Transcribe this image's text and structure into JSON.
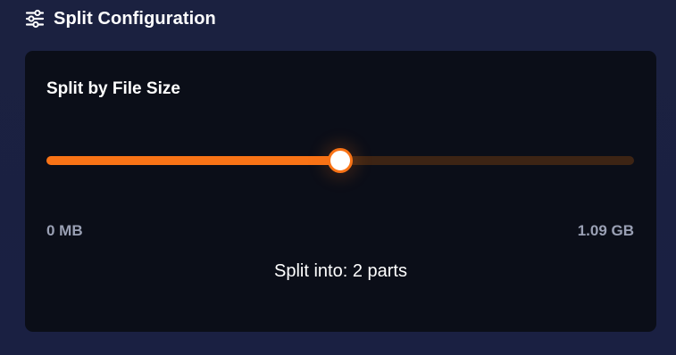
{
  "header": {
    "icon": "sliders-icon",
    "title": "Split Configuration"
  },
  "card": {
    "title": "Split by File Size",
    "slider": {
      "value_fraction": 0.5,
      "min_label": "0 MB",
      "max_label": "1.09 GB"
    },
    "result_text": "Split into: 2 parts"
  },
  "colors": {
    "page_background": "#1b2140",
    "card_background": "#0b0e18",
    "accent": "#f97316",
    "track_background": "#3d2414",
    "muted_text": "#9aa0b4",
    "text": "#ffffff"
  }
}
